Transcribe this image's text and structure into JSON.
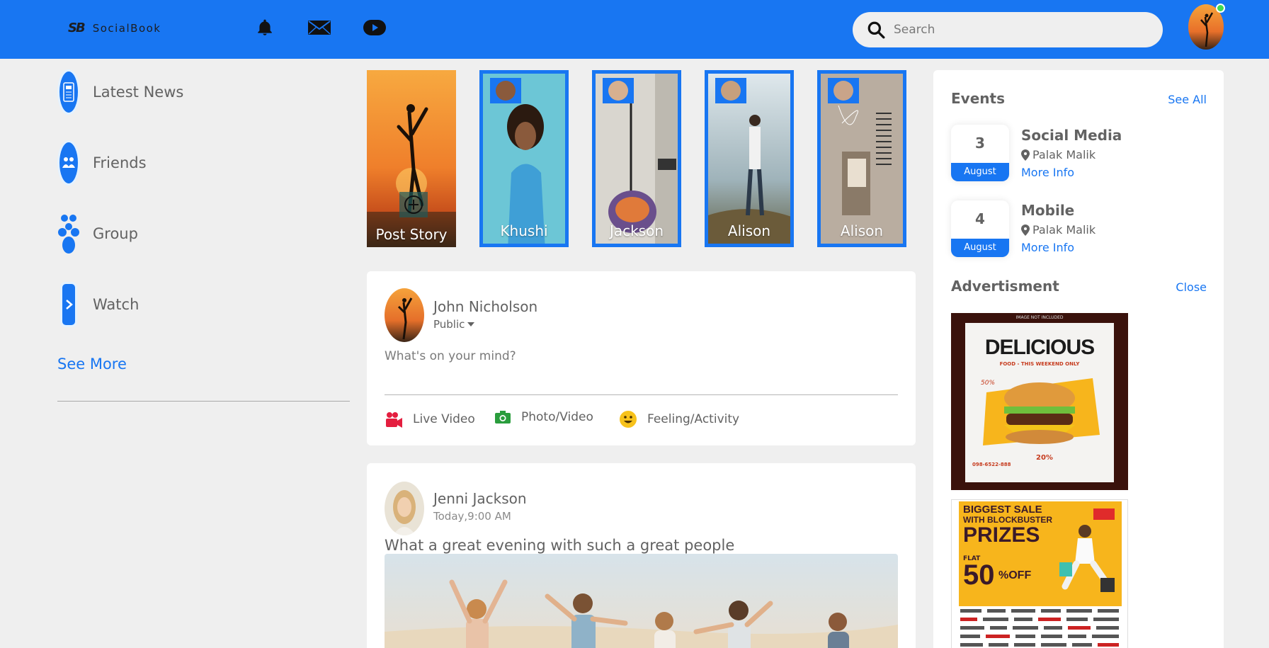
{
  "colors": {
    "brand": "#1876f2",
    "background": "#efefef",
    "text": "#626262",
    "online": "#41db51"
  },
  "header": {
    "logo_mark": "SB",
    "logo_text": "SocialBook",
    "icons": [
      "notification-bell-icon",
      "inbox-mail-icon",
      "video-play-icon"
    ],
    "search_placeholder": "Search"
  },
  "left_sidebar": {
    "items": [
      {
        "label": "Latest News",
        "icon": "news-icon"
      },
      {
        "label": "Friends",
        "icon": "friends-icon"
      },
      {
        "label": "Group",
        "icon": "group-icon"
      },
      {
        "label": "Watch",
        "icon": "watch-icon"
      }
    ],
    "see_more": "See More"
  },
  "stories": [
    {
      "name": "Post Story",
      "icon": "plus-icon"
    },
    {
      "name": "Khushi"
    },
    {
      "name": "Jackson"
    },
    {
      "name": "Alison"
    },
    {
      "name": "Alison"
    }
  ],
  "write_post": {
    "user_name": "John Nicholson",
    "privacy": "Public",
    "placeholder": "What's on your mind?",
    "actions": [
      {
        "label": "Live Video",
        "icon": "live-video-icon"
      },
      {
        "label": "Photo/Video",
        "icon": "camera-icon"
      },
      {
        "label": "Feeling/Activity",
        "icon": "smiley-icon"
      }
    ]
  },
  "post": {
    "user_name": "Jenni Jackson",
    "time": "Today,9:00 AM",
    "text": "What a great evening with such a great people"
  },
  "right_sidebar": {
    "events_title": "Events",
    "events_link": "See All",
    "events": [
      {
        "day": "3",
        "month": "August",
        "title": "Social Media",
        "location": "Palak Malik",
        "more": "More Info"
      },
      {
        "day": "4",
        "month": "August",
        "title": "Mobile",
        "location": "Palak Malik",
        "more": "More Info"
      }
    ],
    "ads_title": "Advertisment",
    "ads_link": "Close",
    "ad1": {
      "top_note": "IMAGE NOT INCLUDED",
      "headline": "DELICIOUS",
      "tagline": "FOOD - THIS WEEKEND ONLY",
      "badge": "50%",
      "discount": "20%",
      "phone": "098-6522-888"
    },
    "ad2": {
      "line1": "BIGGEST SALE",
      "line2": "WITH BLOCKBUSTER",
      "headline": "PRIZES",
      "flat": "FLAT",
      "percent": "50",
      "off": "%OFF"
    }
  }
}
